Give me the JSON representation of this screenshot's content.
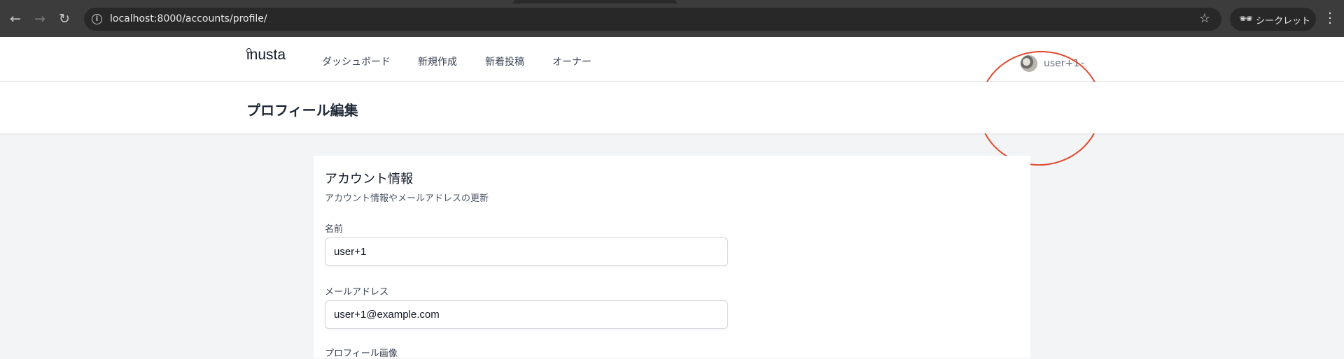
{
  "browser": {
    "url": "localhost:8000/accounts/profile/",
    "incognito_label": "シークレット",
    "icons": {
      "back": "arrow-left-icon",
      "forward": "arrow-right-icon",
      "reload": "reload-icon",
      "info": "info-icon",
      "bookmark": "star-icon",
      "incognito": "incognito-icon",
      "menu": "kebab-menu-icon"
    }
  },
  "navbar": {
    "logo": "inusta",
    "links": [
      "ダッシュボード",
      "新規作成",
      "新着投稿",
      "オーナー"
    ],
    "user_name": "user+1"
  },
  "header": {
    "title": "プロフィール編集"
  },
  "card": {
    "title": "アカウント情報",
    "description": "アカウント情報やメールアドレスの更新",
    "fields": [
      {
        "label": "名前",
        "value": "user+1"
      },
      {
        "label": "メールアドレス",
        "value": "user+1@example.com"
      }
    ],
    "next_label": "プロフィール画像"
  },
  "colors": {
    "annotation": "#e0492e",
    "page_bg": "#f3f4f6",
    "browser_bar": "#3c3c3c"
  }
}
